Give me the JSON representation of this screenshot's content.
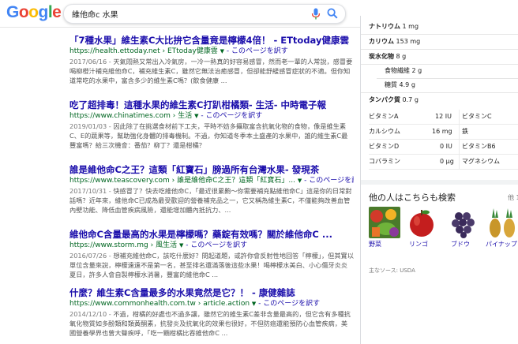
{
  "search": {
    "query": "維他命c 水果"
  },
  "results": [
    {
      "title": "「7種水果」維生素C大比拚它含量竟是檸檬4倍！ - ETtoday健康雲",
      "url": "https://health.ettoday.net",
      "breadcrumb": "ETtoday健康雲",
      "translate": "このページを訳す",
      "snippet_date": "2017/06/16 -",
      "snippet": "天氣悶熱又常出入冷氣房，一冷一熱真的好容易感冒，然而老一輩的人常說，感冒要喝柳橙汁補充維他命C，補充維生素C，雖然它無法治癒感冒，但卻能舒緩感冒症狀的不適。但你知道常吃的水果中，富含多少的維生素C嗎？(飲食健康 ..."
    },
    {
      "title": "吃了超排毒！這種水果的維生素C打趴柑橘類- 生活- 中時電子報",
      "url": "https://www.chinatimes.com",
      "breadcrumb": "生活",
      "translate": "このページを訳す",
      "snippet_date": "2019/01/03 -",
      "snippet": "因此除了在挑選食材前下工夫，平時不妨多攝取富含抗氧化物的食物，像是維生素C、E的蔬果等，幫助強化身體的排毒機制。不過，你知道冬季本土盛產的水果中，誰的維生素C最豐富嗎？給三次機會：番茄？柳丁？還是柑橘？"
    },
    {
      "title": "誰是維他命C之王？這類「紅寶石」膀過所有台灣水果- 發現茶",
      "url": "https://www.teascovery.com",
      "breadcrumb": "誰是維他命C之王？這類「紅寶石」...",
      "translate": "このページを訳す",
      "snippet_date": "2017/10/31 -",
      "snippet": "快感冒了？快去吃維他命C，「最近很累齁～你需要補充點維他命C」這是你的日常對話嗎？近年來，維他命C已成為最受歡迎的營養補充品之一，它又稱為維生素C，不僅能夠改善血管內壁功能、降低血管疾病風險，還能增加體內抵抗力、..."
    },
    {
      "title": "維他命C含量最高的水果是檸檬嗎？藥錠有效嗎？關於維他命C ...",
      "url": "https://www.storm.mg",
      "breadcrumb": "風生活",
      "translate": "このページを訳す",
      "snippet_date": "2016/07/26 -",
      "snippet": "想補充維他命C，該吃什麼好？問起道題，或許你會反射性地回答「檸檬」，但其實以單位含量來說，檸檬遠遠不是第一名，甚至排名還滿落後這些水果！喝檸檬水美白、小心傷牙炎炎夏日，許多人會自製檸檬水消暑，豐富的維他命C ..."
    },
    {
      "title": "什麼？維生素C含量最多的水果竟然是它？！ - 康健雜誌",
      "url": "https://www.commonhealth.com.tw",
      "breadcrumb": "article.action",
      "translate": "このページを訳す",
      "snippet_date": "2014/12/10 -",
      "snippet": "不過，柑橘的好處也不過多讓，雖然它的維生素C差非含量最高的，但它含有多種抗氧化物質如多酚類和類黃酮素，抗發炎及抗氧化的效果也很好，不但防癌還能預防心血管疾病，美國營養學界也曾大聲疾呼，「吃一顆柑橘比吞維他命C ..."
    }
  ],
  "panel": {
    "sodium": {
      "label": "ナトリウム",
      "value": "1 mg"
    },
    "potassium": {
      "label": "カリウム",
      "value": "153 mg"
    },
    "carbs": {
      "label": "炭水化物",
      "value": "8 g"
    },
    "fiber": {
      "label": "食物繊維",
      "value": "2 g"
    },
    "sugar": {
      "label": "糖質",
      "value": "4.9 g"
    },
    "protein": {
      "label": "タンパク質",
      "value": "0.7 g"
    },
    "vitamins": [
      {
        "l1": "ビタミンA",
        "v1": "12 IU",
        "l2": "ビタミンC",
        "v2": ""
      },
      {
        "l1": "カルシウム",
        "v1": "16 mg",
        "l2": "鉄",
        "v2": ""
      },
      {
        "l1": "ビタミンD",
        "v1": "0 IU",
        "l2": "ビタミンB6",
        "v2": ""
      },
      {
        "l1": "コバラミン",
        "v1": "0 µg",
        "l2": "マグネシウム",
        "v2": ""
      }
    ],
    "others_title": "他の人はこちらも検索",
    "others_more": "他 15",
    "thumbs": [
      {
        "label": "野菜"
      },
      {
        "label": "リンゴ"
      },
      {
        "label": "ブドウ"
      },
      {
        "label": "パイナップ"
      }
    ],
    "source": "主なソース: USDA"
  },
  "colors": {
    "link": "#1a0dab",
    "url_green": "#006621",
    "snippet": "#545454"
  }
}
